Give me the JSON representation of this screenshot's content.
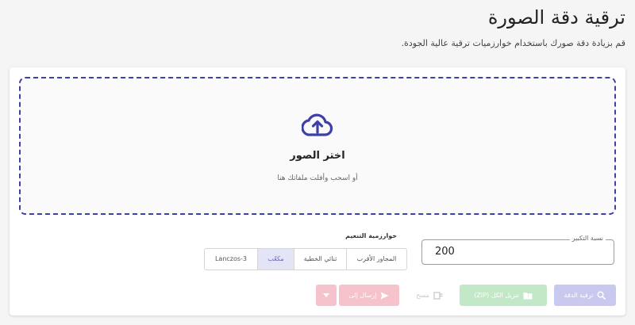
{
  "header": {
    "title": "ترقية دقة الصورة",
    "subtitle": "قم بزيادة دقة صورك باستخدام خوارزميات ترقية عالية الجودة."
  },
  "dropzone": {
    "icon": "cloud-upload-icon",
    "title": "اختر الصور",
    "hint": "أو اسحب وأفلت ملفاتك هنا"
  },
  "scale": {
    "label": "نسبة التكبير",
    "value": "200"
  },
  "algorithm": {
    "label": "خوارزمية التنعيم",
    "options": [
      "المجاور الأقرب",
      "ثنائي الخطية",
      "مكعّب",
      "Lanczos-3"
    ],
    "selected": "مكعّب"
  },
  "actions": {
    "upscale": "ترقية الدقة",
    "download_zip": "تنزيل الكل (ZIP)",
    "clear": "مسح",
    "send_to": "إرسال إلى"
  },
  "colors": {
    "accent": "#3f3fa8",
    "upscale_disabled": "#c9c9ef",
    "zip_disabled": "#c3e8c8",
    "send_disabled": "#f6c3cc"
  }
}
